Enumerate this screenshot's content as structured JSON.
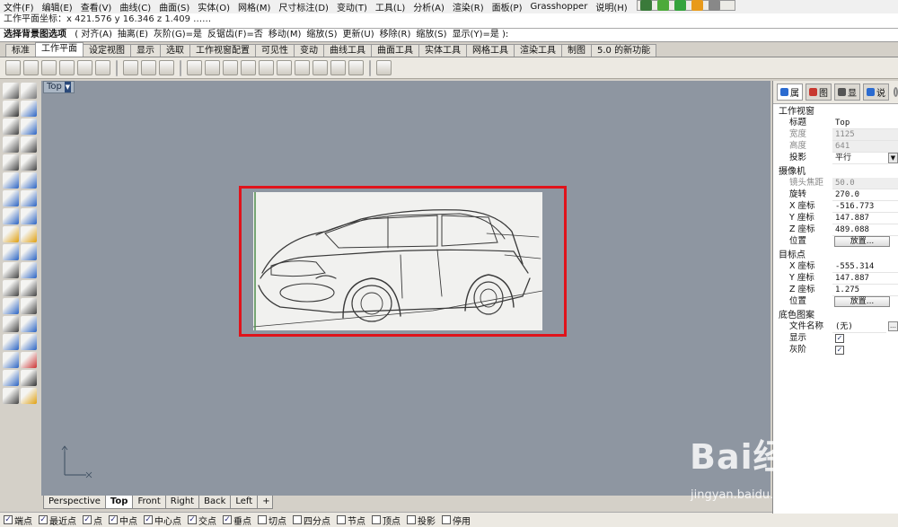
{
  "menubar": {
    "items": [
      "文件(F)",
      "编辑(E)",
      "查看(V)",
      "曲线(C)",
      "曲面(S)",
      "实体(O)",
      "网格(M)",
      "尺寸标注(D)",
      "变动(T)",
      "工具(L)",
      "分析(A)",
      "渲染(R)",
      "面板(P)",
      "Grasshopper",
      "说明(H)"
    ]
  },
  "command_history": "工作平面坐标：x 421.576 y 16.346 z 1.409 ……",
  "command_prompt": {
    "label": "选择背景图选项",
    "options": [
      "( 对齐(A)",
      "抽离(E)",
      "灰阶(G)=是",
      "反锯齿(F)=否",
      "移动(M)",
      "缩放(S)",
      "更新(U)",
      "移除(R)",
      "缩放(S)",
      "显示(Y)=是 ):"
    ]
  },
  "toolbar_tabs": [
    "标准",
    "工作平面",
    "设定视图",
    "显示",
    "选取",
    "工作视窗配置",
    "可见性",
    "变动",
    "曲线工具",
    "曲面工具",
    "实体工具",
    "网格工具",
    "渲染工具",
    "制图",
    "5.0 的新功能"
  ],
  "active_toolbar_tab": "工作平面",
  "viewport": {
    "title": "Top",
    "arrow": "▼"
  },
  "view_tabs": [
    "Perspective",
    "Top",
    "Front",
    "Right",
    "Back",
    "Left"
  ],
  "view_tabs_plus": "+",
  "snaps": [
    {
      "label": "端点",
      "checked": true
    },
    {
      "label": "最近点",
      "checked": true
    },
    {
      "label": "点",
      "checked": true
    },
    {
      "label": "中点",
      "checked": true
    },
    {
      "label": "中心点",
      "checked": true
    },
    {
      "label": "交点",
      "checked": true
    },
    {
      "label": "垂点",
      "checked": true
    },
    {
      "label": "切点",
      "checked": false
    },
    {
      "label": "四分点",
      "checked": false
    },
    {
      "label": "节点",
      "checked": false
    },
    {
      "label": "顶点",
      "checked": false
    },
    {
      "label": "投影",
      "checked": false
    },
    {
      "label": "停用",
      "checked": false
    }
  ],
  "panel": {
    "tabs": [
      "属",
      "图",
      "显",
      "说"
    ],
    "viewport_section": "工作视窗",
    "title_key": "标题",
    "title_val": "Top",
    "width_key": "宽度",
    "width_val": "1125",
    "height_key": "高度",
    "height_val": "641",
    "projection_key": "投影",
    "projection_val": "平行",
    "camera_section": "摄像机",
    "lens_key": "镜头焦距",
    "lens_val": "50.0",
    "rotation_key": "旋转",
    "rotation_val": "270.0",
    "cam_x_key": "X 座标",
    "cam_x_val": "-516.773",
    "cam_y_key": "Y 座标",
    "cam_y_val": "147.887",
    "cam_z_key": "Z 座标",
    "cam_z_val": "489.088",
    "cam_pos_key": "位置",
    "cam_pos_btn": "放置...",
    "target_section": "目标点",
    "tgt_x_key": "X 座标",
    "tgt_x_val": "-555.314",
    "tgt_y_key": "Y 座标",
    "tgt_y_val": "147.887",
    "tgt_z_key": "Z 座标",
    "tgt_z_val": "1.275",
    "tgt_pos_key": "位置",
    "tgt_pos_btn": "放置...",
    "bg_section": "底色图案",
    "file_key": "文件名称",
    "file_val": "(无)",
    "show_key": "显示",
    "gray_key": "灰阶"
  },
  "watermark": {
    "logo": "Bai经验",
    "sub": "jingyan.baidu.com"
  },
  "colors": {
    "viewport": "#8e96a1",
    "selection": "#e0131b"
  }
}
